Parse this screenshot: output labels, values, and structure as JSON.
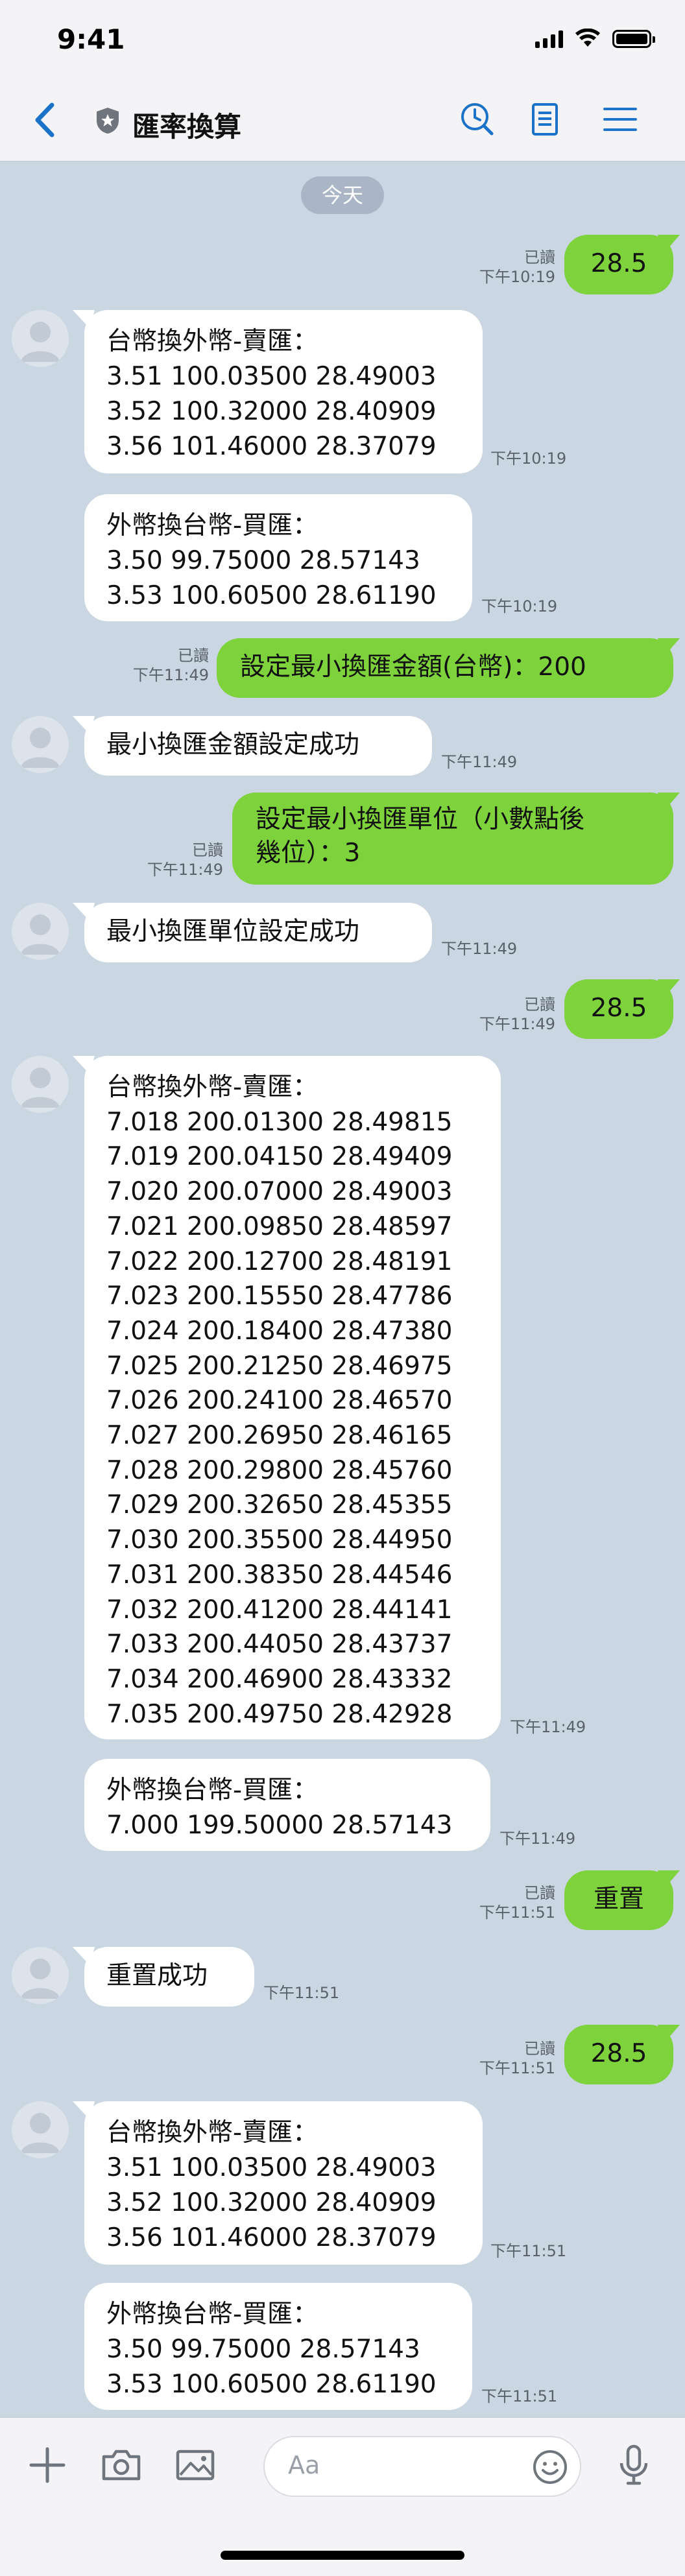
{
  "status": {
    "time": "9:41"
  },
  "nav": {
    "title": "匯率換算",
    "back_icon": "chevron-left-icon",
    "icons": [
      "clock-icon",
      "notes-icon",
      "menu-icon"
    ]
  },
  "day_label": "今天",
  "messages": [
    {
      "dir": "out",
      "text": "28.5",
      "read": "已讀",
      "time": "下午10:19"
    },
    {
      "dir": "in",
      "text": "台幣換外幣-賣匯：\n3.51 100.03500 28.49003\n3.52 100.32000 28.40909\n3.56 101.46000 28.37079",
      "time": "下午10:19"
    },
    {
      "dir": "in",
      "text": "外幣換台幣-買匯：\n3.50 99.75000 28.57143\n3.53 100.60500 28.61190",
      "time": "下午10:19"
    },
    {
      "dir": "out",
      "text": "設定最小換匯金額(台幣)：200",
      "read": "已讀",
      "time": "下午11:49"
    },
    {
      "dir": "in",
      "text": "最小換匯金額設定成功",
      "time": "下午11:49"
    },
    {
      "dir": "out",
      "text": "設定最小換匯單位（小數點後\n幾位）：3",
      "read": "已讀",
      "time": "下午11:49"
    },
    {
      "dir": "in",
      "text": "最小換匯單位設定成功",
      "time": "下午11:49"
    },
    {
      "dir": "out",
      "text": "28.5",
      "read": "已讀",
      "time": "下午11:49"
    },
    {
      "dir": "in",
      "text": "台幣換外幣-賣匯：\n7.018 200.01300 28.49815\n7.019 200.04150 28.49409\n7.020 200.07000 28.49003\n7.021 200.09850 28.48597\n7.022 200.12700 28.48191\n7.023 200.15550 28.47786\n7.024 200.18400 28.47380\n7.025 200.21250 28.46975\n7.026 200.24100 28.46570\n7.027 200.26950 28.46165\n7.028 200.29800 28.45760\n7.029 200.32650 28.45355\n7.030 200.35500 28.44950\n7.031 200.38350 28.44546\n7.032 200.41200 28.44141\n7.033 200.44050 28.43737\n7.034 200.46900 28.43332\n7.035 200.49750 28.42928",
      "time": "下午11:49"
    },
    {
      "dir": "in",
      "text": "外幣換台幣-買匯：\n7.000 199.50000 28.57143",
      "time": "下午11:49"
    },
    {
      "dir": "out",
      "text": "重置",
      "read": "已讀",
      "time": "下午11:51"
    },
    {
      "dir": "in",
      "text": "重置成功",
      "time": "下午11:51"
    },
    {
      "dir": "out",
      "text": "28.5",
      "read": "已讀",
      "time": "下午11:51"
    },
    {
      "dir": "in",
      "text": "台幣換外幣-賣匯：\n3.51 100.03500 28.49003\n3.52 100.32000 28.40909\n3.56 101.46000 28.37079",
      "time": "下午11:51"
    },
    {
      "dir": "in",
      "text": "外幣換台幣-買匯：\n3.50 99.75000 28.57143\n3.53 100.60500 28.61190",
      "time": "下午11:51"
    }
  ],
  "input": {
    "placeholder": "Aa"
  },
  "toolbar_icons": [
    "plus-icon",
    "camera-icon",
    "image-icon",
    "emoji-icon",
    "microphone-icon"
  ],
  "colors": {
    "background": "#cbd6e3",
    "outgoing_bubble": "#7ed23c",
    "incoming_bubble": "#ffffff",
    "accent": "#1a73c8"
  }
}
